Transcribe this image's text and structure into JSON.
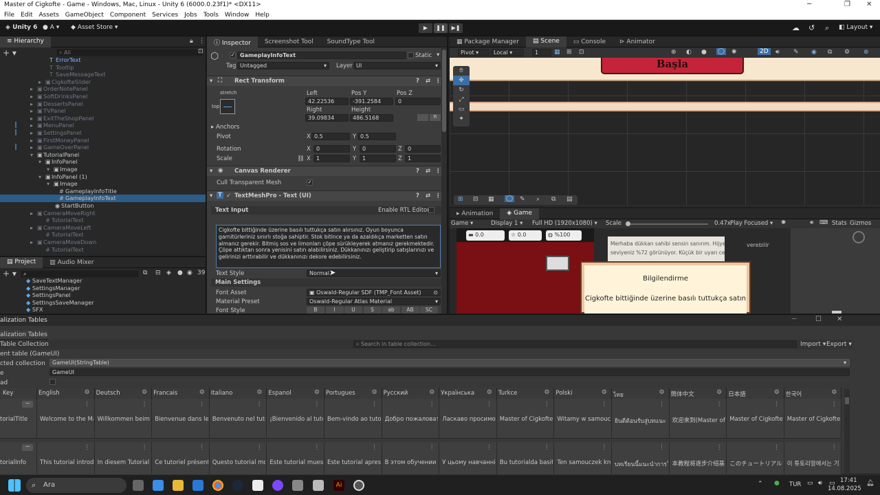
{
  "window": {
    "title": "Master of Cigkofte - Game - Windows, Mac, Linux - Unity 6 (6000.0.23f1)* <DX11>"
  },
  "menu": [
    "File",
    "Edit",
    "Assets",
    "GameObject",
    "Component",
    "Services",
    "Jobs",
    "Tools",
    "Window",
    "Help"
  ],
  "toolbar": {
    "unity_label": "Unity 6",
    "account": "A",
    "asset_store": "Asset Store",
    "layout": "Layout"
  },
  "hierarchy": {
    "tab": "Hierarchy",
    "search_placeholder": "All",
    "items": [
      {
        "label": "ErrorText",
        "dim": false
      },
      {
        "label": "Tooltip",
        "dim": true
      },
      {
        "label": "SaveMessageText",
        "dim": true
      },
      {
        "label": "CigkofteSlider",
        "dim": true
      },
      {
        "label": "OrderNotePanel",
        "dim": true
      },
      {
        "label": "SoftDrinksPanel",
        "dim": true
      },
      {
        "label": "DessertsPanel",
        "dim": true
      },
      {
        "label": "TVPanel",
        "dim": true
      },
      {
        "label": "ExitTheShopPanel",
        "dim": true
      },
      {
        "label": "MenuPanel",
        "dim": true
      },
      {
        "label": "SettingsPanel",
        "dim": true
      },
      {
        "label": "FirstMoneyPanel",
        "dim": true
      },
      {
        "label": "GameOverPanel",
        "dim": true
      },
      {
        "label": "TutorialPanel",
        "dim": false
      },
      {
        "label": "InfoPanel",
        "dim": false
      },
      {
        "label": "Image",
        "dim": false
      },
      {
        "label": "InfoPanel (1)",
        "dim": false
      },
      {
        "label": "Image",
        "dim": false
      },
      {
        "label": "GameplayInfoTitle",
        "dim": false
      },
      {
        "label": "GameplayInfoText",
        "dim": false
      },
      {
        "label": "StartButton",
        "dim": false
      },
      {
        "label": "CameraMoveRight",
        "dim": true
      },
      {
        "label": "TutorialText",
        "dim": true
      },
      {
        "label": "CameraMoveLeft",
        "dim": true
      },
      {
        "label": "TutorialText",
        "dim": true
      },
      {
        "label": "CameraMoveDown",
        "dim": true
      },
      {
        "label": "TutorialText",
        "dim": true
      }
    ]
  },
  "project": {
    "tab": "Project",
    "tab2": "Audio Mixer",
    "count": "39",
    "items": [
      "SaveTextManager",
      "SettingsManager",
      "SettingsPanel",
      "SettingsSaveManager",
      "SFX"
    ]
  },
  "inspector": {
    "tab": "Inspector",
    "tab2": "Screenshot Tool",
    "tab3": "SoundType Tool",
    "object_name": "GameplayInfoText",
    "static": "Static",
    "tag_label": "Tag",
    "tag": "Untagged",
    "layer_label": "Layer",
    "layer": "UI",
    "rect": {
      "title": "Rect Transform",
      "stretch": "stretch",
      "top": "top",
      "left_label": "Left",
      "left": "42.22536",
      "posy_label": "Pos Y",
      "posy": "-391.2584",
      "posz_label": "Pos Z",
      "posz": "0",
      "right_label": "Right",
      "right": "39.09834",
      "height_label": "Height",
      "height": "486.5168",
      "anchors": "Anchors",
      "pivot_label": "Pivot",
      "pivot_x": "0.5",
      "pivot_y": "0.5",
      "rotation_label": "Rotation",
      "rot_x": "0",
      "rot_y": "0",
      "rot_z": "0",
      "scale_label": "Scale",
      "scale_x": "1",
      "scale_y": "1",
      "scale_z": "1",
      "x": "X",
      "y": "Y",
      "z": "Z"
    },
    "canvas_renderer": {
      "title": "Canvas Renderer",
      "cull": "Cull Transparent Mesh"
    },
    "tmp": {
      "title": "TextMeshPro - Text (UI)",
      "text_input": "Text Input",
      "rtl": "Enable RTL Editor",
      "text": "Cigkofte bittiğinde üzerine basılı tuttukça satın alırsınız. Oyun boyunca garnitürleriniz sınırlı stoğa sahiptir. Stok bitince ya da azaldıkça marketten satın almanız gerekir. Bitmiş sos ve limonları çöpe sürükleyerek atmanız gerekmektedir. Çöpe attıktan sonra yenisini satın alabilirsiniz. Dükkanınızı geliştirip satışlarınızı ve gelirinizi arttırabilir ve dükkanınızı dekore edebilirsiniz.",
      "text_style_label": "Text Style",
      "text_style": "Normal",
      "main_settings": "Main Settings",
      "font_asset_label": "Font Asset",
      "font_asset": "Oswald-Regular SDF (TMP_Font Asset)",
      "material_label": "Material Preset",
      "material": "Oswald-Regular Atlas Material",
      "font_style_label": "Font Style",
      "font_style_btns": [
        "B",
        "I",
        "U",
        "S",
        "ab",
        "AB",
        "SC"
      ]
    }
  },
  "scene": {
    "tabs": [
      "Package Manager",
      "Scene",
      "Console",
      "Animator"
    ],
    "pivot": "Pivot",
    "local": "Local",
    "grid_num": "1",
    "mode2d": "2D",
    "button_text": "Başla"
  },
  "game": {
    "tabs": [
      "Animation",
      "Game"
    ],
    "display_mode": "Game",
    "display": "Display 1",
    "resolution": "Full HD (1920x1080)",
    "scale_label": "Scale",
    "scale": "0.47x",
    "play_focused": "Play Focused",
    "stats": "Stats",
    "gizmos": "Gizmos",
    "hud": [
      "0.0",
      "0.0",
      "%100"
    ],
    "dialog_title": "Bilgilendirme",
    "dialog_text": "Cigkofte bittiğinde üzerine basılı tuttukça satın",
    "bg_text1": "Merhaba dükkan sahibi sensin sanırım. Hijyen",
    "bg_text2": "seviyeniz %72 görünüyor. Küçük bir uyarı cezası",
    "bg_text3": "verebilir"
  },
  "localization": {
    "title": "alization Tables",
    "tab": "alization Tables",
    "table_collection": "Table Collection",
    "current_table": "ent table (GameUI)",
    "search_placeholder": "Search in table collection...",
    "import": "Import",
    "export": "Export",
    "selected_label": "cted collection",
    "selected": "GameUI(StringTable)",
    "name_label": "e",
    "name": "GameUI",
    "preload_label": "ad",
    "columns": [
      "Key",
      "English",
      "Deutsch",
      "Francais",
      "Italiano",
      "Espanol",
      "Portugues",
      "Русский",
      "Українська",
      "Turkce",
      "Polski",
      "ไทย",
      "簡体中文",
      "日本語",
      "한국어"
    ],
    "rows": [
      {
        "key": "torialTitle",
        "values": [
          "Welcome to the Ma",
          "Willkommen beim M",
          "Bienvenue dans le t",
          "Benvenuto nel tutor",
          "¡Bienvenido al tutor",
          "Bem-vindo ao tutor",
          "Добро пожаловать",
          "Ласкаво просимо д",
          "Master of Cigkofte",
          "Witamy w samoucz",
          "ยินดีต้อนรับสู่บทแนะ Ma",
          "欢迎来到(Master of",
          "Master of Cigkofte",
          "Master of Cigkofte"
        ]
      },
      {
        "key": "torialInfo",
        "values": [
          "This tutorial introdu",
          "In diesem Tutorial w",
          "Ce tutoriel présente",
          "Questo tutorial mos",
          "Este tutorial muestr",
          "Este tutorial aprese",
          "В этом обучении п",
          "У цьому навчанні г",
          "Bu tutorialda basit c",
          "Ten samouczek kro",
          "บทเรียนนี้แนะนำการใช้",
          "本教程将逐步介绍基",
          "このチュートリアルでは、ゴ",
          "이 튜토리얼에서는 기"
        ]
      }
    ]
  },
  "taskbar": {
    "search": "Ara",
    "lang": "TUR",
    "time": "17:41",
    "date": "14.08.2025"
  }
}
